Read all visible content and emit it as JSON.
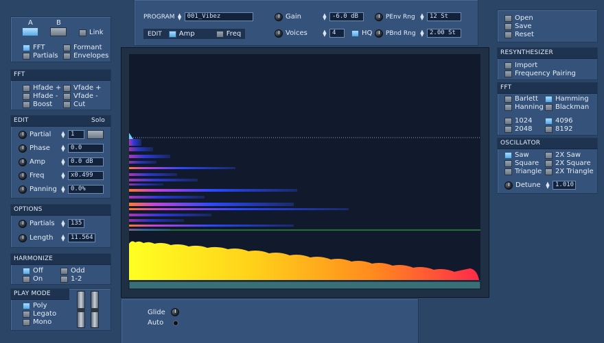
{
  "left": {
    "ab": {
      "a_label": "A",
      "b_label": "B",
      "link_label": "Link"
    },
    "view": {
      "fft_label": "FFT",
      "formant_label": "Formant",
      "partials_label": "Partials",
      "envelopes_label": "Envelopes"
    },
    "fft": {
      "title": "FFT",
      "hfade_plus": "Hfade +",
      "vfade_plus": "Vfade +",
      "hfade_minus": "Hfade -",
      "vfade_minus": "Vfade -",
      "boost": "Boost",
      "cut": "Cut"
    },
    "edit": {
      "title": "EDIT",
      "solo": "Solo",
      "partial_label": "Partial",
      "partial_value": "1",
      "phase_label": "Phase",
      "phase_value": "0.0",
      "amp_label": "Amp",
      "amp_value": "0.0 dB",
      "freq_label": "Freq",
      "freq_value": "x0.499",
      "panning_label": "Panning",
      "panning_value": "0.0%"
    },
    "options": {
      "title": "OPTIONS",
      "partials_label": "Partials",
      "partials_value": "135",
      "length_label": "Length",
      "length_value": "11.564"
    },
    "harmonize": {
      "title": "HARMONIZE",
      "off": "Off",
      "on": "On",
      "odd": "Odd",
      "one_two": "1-2"
    },
    "playmode": {
      "title": "PLAY MODE",
      "poly": "Poly",
      "legato": "Legato",
      "mono": "Mono"
    }
  },
  "top": {
    "program_label": "PROGRAM",
    "program_value": "001_Vibez",
    "edit_label": "EDIT",
    "amp_label": "Amp",
    "freq_label": "Freq",
    "gain_label": "Gain",
    "gain_value": "-6.0 dB",
    "voices_label": "Voices",
    "voices_value": "4",
    "hq_label": "HQ",
    "penv_label": "PEnv Rng",
    "penv_value": "12 St",
    "pbnd_label": "PBnd Rng",
    "pbnd_value": "2.00 St"
  },
  "bottom": {
    "glide_label": "Glide",
    "auto_label": "Auto"
  },
  "right": {
    "file": {
      "open": "Open",
      "save": "Save",
      "reset": "Reset"
    },
    "resynth": {
      "title": "RESYNTHESIZER",
      "import": "Import",
      "freq_pairing": "Frequency Pairing"
    },
    "fft": {
      "title": "FFT",
      "barlett": "Barlett",
      "hamming": "Hamming",
      "hanning": "Hanning",
      "blackman": "Blackman",
      "s1024": "1024",
      "s4096": "4096",
      "s2048": "2048",
      "s8192": "8192"
    },
    "osc": {
      "title": "OSCILLATOR",
      "saw": "Saw",
      "saw2x": "2X Saw",
      "square": "Square",
      "square2x": "2X Square",
      "triangle": "Triangle",
      "triangle2x": "2X Triangle",
      "detune_label": "Detune",
      "detune_value": "1.010"
    }
  },
  "colors": {
    "accent": "#5aa9e6",
    "display_bg": "#111a2c"
  },
  "icons": {
    "knob": "rotary-knob-icon",
    "spinner": "up-down-arrows-icon"
  }
}
